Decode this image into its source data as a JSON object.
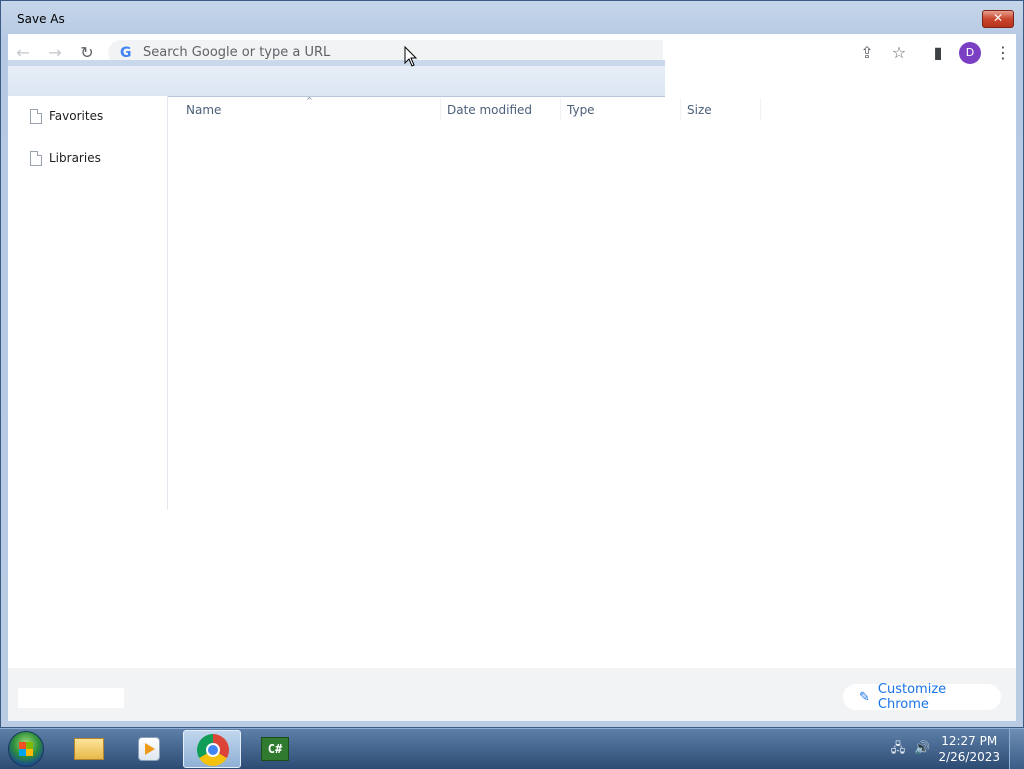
{
  "window": {
    "title": "Save As",
    "close_label": "✕"
  },
  "browser": {
    "back_icon": "←",
    "forward_icon": "→",
    "reload_icon": "↻",
    "omnibox_logo": "G",
    "omnibox_placeholder": "Search Google or type a URL",
    "share_icon": "⇪",
    "bookmark_icon": "☆",
    "side_panel_icon": "▮",
    "profile_initial": "D",
    "menu_icon": "⋮",
    "customize_label": "Customize Chrome",
    "customize_icon": "✎"
  },
  "dialog": {
    "nav_items": [
      {
        "label": "Favorites"
      },
      {
        "label": "Libraries"
      }
    ],
    "columns": {
      "name": "Name",
      "date_modified": "Date modified",
      "type": "Type",
      "size": "Size"
    }
  },
  "taskbar": {
    "apps": [
      {
        "name": "Windows Explorer"
      },
      {
        "name": "Windows Media Player"
      },
      {
        "name": "Google Chrome",
        "active": true
      },
      {
        "name": "C# Project"
      }
    ],
    "csharp_label": "C#",
    "clock_time": "12:27 PM",
    "clock_date": "2/26/2023",
    "network_icon": "🖧",
    "volume_icon": "🔊"
  },
  "colors": {
    "accent": "#1a73e8",
    "profile": "#7b3fc4",
    "close_button": "#c9462c"
  }
}
